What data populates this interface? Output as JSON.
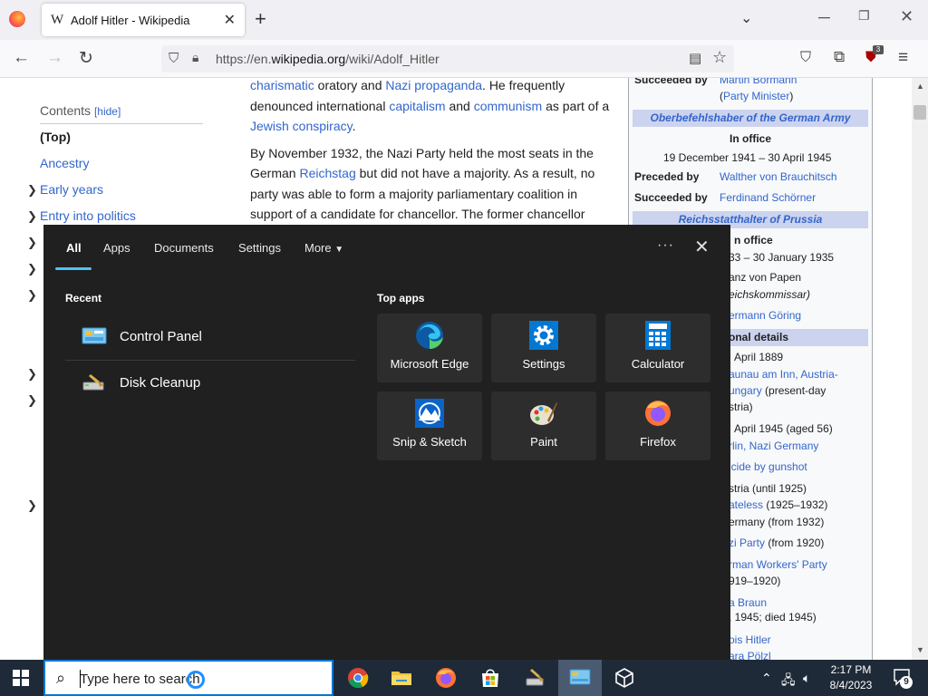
{
  "browser": {
    "tab_title": "Adolf Hitler - Wikipedia",
    "tab_logo": "W",
    "new_tab": "+",
    "url_prefix": "https://en.",
    "url_domain": "wikipedia.org",
    "url_path": "/wiki/Adolf_Hitler",
    "extension_badge": "3"
  },
  "toc": {
    "title": "Contents",
    "hide_label": "[hide]",
    "items": [
      "(Top)",
      "Ancestry",
      "Early years",
      "Entry into politics"
    ]
  },
  "article": {
    "p1_a": "charismatic",
    "p1_b": " oratory and ",
    "p1_c": "Nazi propaganda",
    "p1_d": ". He frequently denounced international ",
    "p1_e": "capitalism",
    "p1_f": " and ",
    "p1_g": "communism",
    "p1_h": " as part of a ",
    "p1_i": "Jewish conspiracy",
    "p1_j": ".",
    "p2_a": "By November 1932, the Nazi Party held the most seats in the German ",
    "p2_b": "Reichstag",
    "p2_c": " but did not have a majority. As a result, no party was able to form a majority parliamentary coalition in support of a candidate for chancellor. The former chancellor"
  },
  "infobox": {
    "succeeded_by_label": "Succeeded by",
    "succeeded_by_1": "Martin Bormann",
    "party_minister": "(Party Minister)",
    "head_army": "Oberbefehlshaber of the German Army",
    "in_office": "In office",
    "army_dates": "19 December 1941 – 30 April 1945",
    "preceded_by_label": "Preceded by",
    "preceded_by": "Walther von Brauchitsch",
    "succeeded_by_2": "Ferdinand Schörner",
    "head_prussia": "Reichsstatthalter of Prussia",
    "in_office_partial": "n office",
    "prussia_dates": "33 – 30 January 1935",
    "papen": "anz von Papen",
    "reichskommissar": "eichskommissar)",
    "goering": "ermann Göring",
    "personal": "onal details",
    "born_date": "April 1889",
    "braunau": "aunau am Inn, Austria-",
    "hungary": "ungary",
    "present_day": " (present-day",
    "stria": "stria)",
    "died": "April 1945 (aged 56)",
    "berlin": "rlin",
    "nazi_germany": ", Nazi Germany",
    "suicide": "icide by gunshot",
    "austria": "stria (until 1925)",
    "stateless": "ateless",
    "stateless_years": " (1925–1932)",
    "germany": "ermany (from 1932)",
    "nazi_party": "zi Party",
    "nazi_party_years": " (from 1920)",
    "workers": "rman Workers' Party",
    "workers_years": "919–1920)",
    "braun": "a Braun",
    "braun_years": ", 1945; died 1945)",
    "alois": "ois Hitler",
    "klara": "ara Pölzl"
  },
  "search_panel": {
    "tabs": [
      "All",
      "Apps",
      "Documents",
      "Settings",
      "More"
    ],
    "recent_heading": "Recent",
    "recent_items": [
      "Control Panel",
      "Disk Cleanup"
    ],
    "top_apps_heading": "Top apps",
    "apps": [
      "Microsoft Edge",
      "Settings",
      "Calculator",
      "Snip & Sketch",
      "Paint",
      "Firefox"
    ],
    "more_icon": "···",
    "close_icon": "✕"
  },
  "taskbar": {
    "search_placeholder": "Type here to search",
    "time": "2:17 PM",
    "date": "8/4/2023",
    "notification_count": "9"
  },
  "colors": {
    "accent": "#4cc2ff",
    "link": "#3366cc",
    "panel_bg": "#202020",
    "tile_bg": "#2d2d2d",
    "taskbar_bg": "#1f2a38"
  }
}
